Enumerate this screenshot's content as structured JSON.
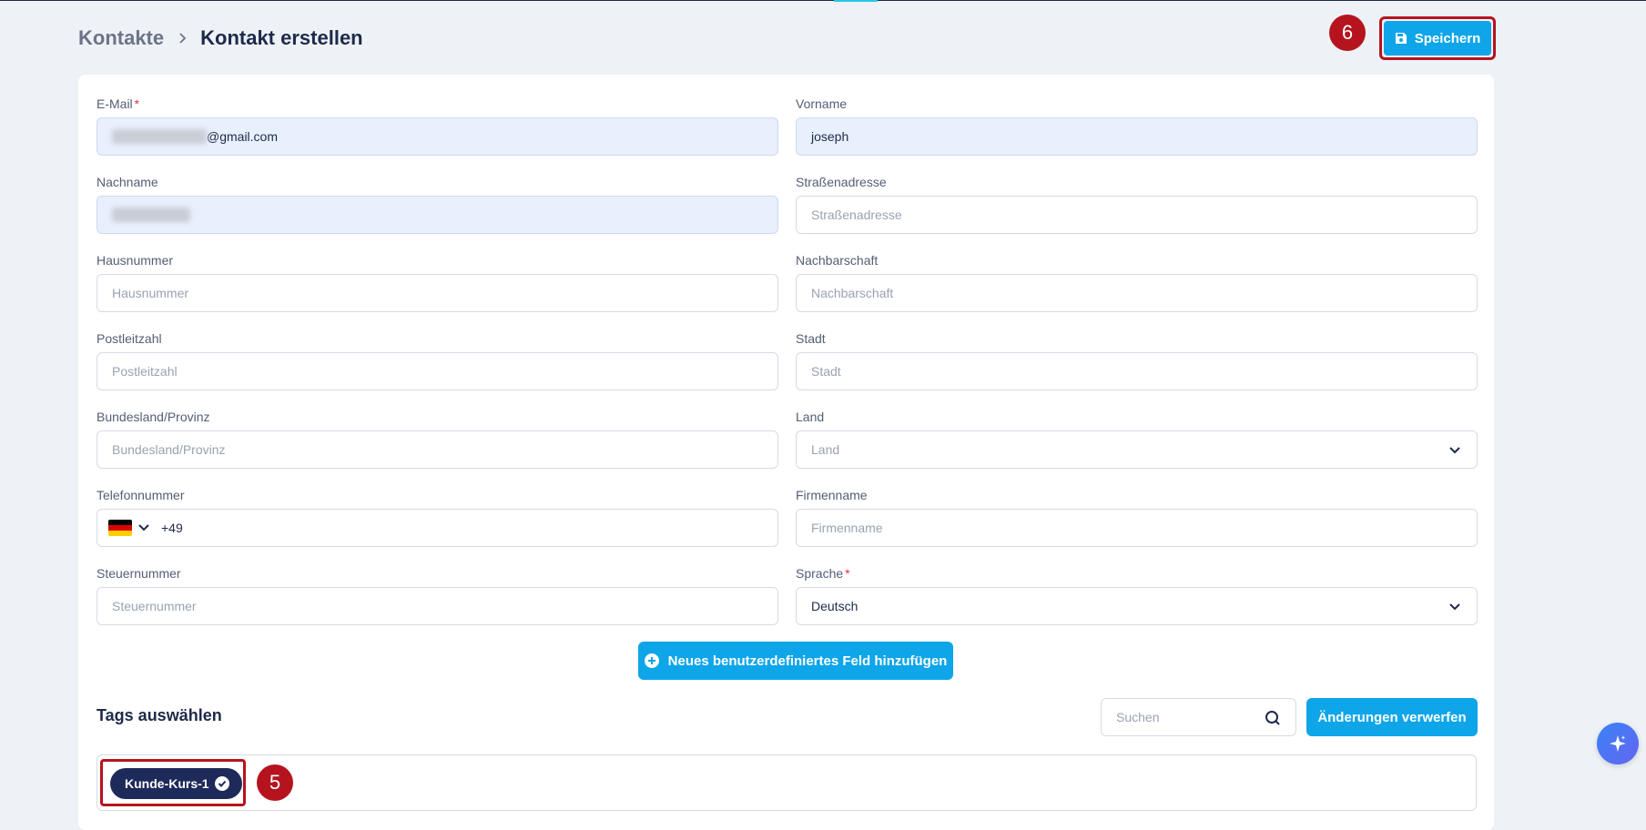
{
  "breadcrumb": {
    "root": "Kontakte",
    "current": "Kontakt erstellen"
  },
  "toolbar": {
    "save_label": "Speichern"
  },
  "annotations": {
    "save_step": "6",
    "tag_step": "5"
  },
  "form": {
    "email": {
      "label": "E-Mail",
      "required": "*",
      "value_suffix": "@gmail.com"
    },
    "vorname": {
      "label": "Vorname",
      "value": "joseph"
    },
    "nachname": {
      "label": "Nachname"
    },
    "strasse": {
      "label": "Straßenadresse",
      "placeholder": "Straßenadresse"
    },
    "hausnummer": {
      "label": "Hausnummer",
      "placeholder": "Hausnummer"
    },
    "nachbarschaft": {
      "label": "Nachbarschaft",
      "placeholder": "Nachbarschaft"
    },
    "plz": {
      "label": "Postleitzahl",
      "placeholder": "Postleitzahl"
    },
    "stadt": {
      "label": "Stadt",
      "placeholder": "Stadt"
    },
    "bundesland": {
      "label": "Bundesland/Provinz",
      "placeholder": "Bundesland/Provinz"
    },
    "land": {
      "label": "Land",
      "placeholder": "Land"
    },
    "telefon": {
      "label": "Telefonnummer",
      "value": "+49"
    },
    "firmenname": {
      "label": "Firmenname",
      "placeholder": "Firmenname"
    },
    "steuernummer": {
      "label": "Steuernummer",
      "placeholder": "Steuernummer"
    },
    "sprache": {
      "label": "Sprache",
      "required": "*",
      "value": "Deutsch"
    }
  },
  "add_field_label": "Neues benutzerdefiniertes Feld hinzufügen",
  "tags": {
    "title": "Tags auswählen",
    "search_placeholder": "Suchen",
    "discard_label": "Änderungen verwerfen",
    "items": [
      {
        "label": "Kunde-Kurs-1"
      }
    ]
  },
  "colors": {
    "accent": "#0ea5e9",
    "navy": "#1e2a5a",
    "annotation": "#b5141e"
  }
}
